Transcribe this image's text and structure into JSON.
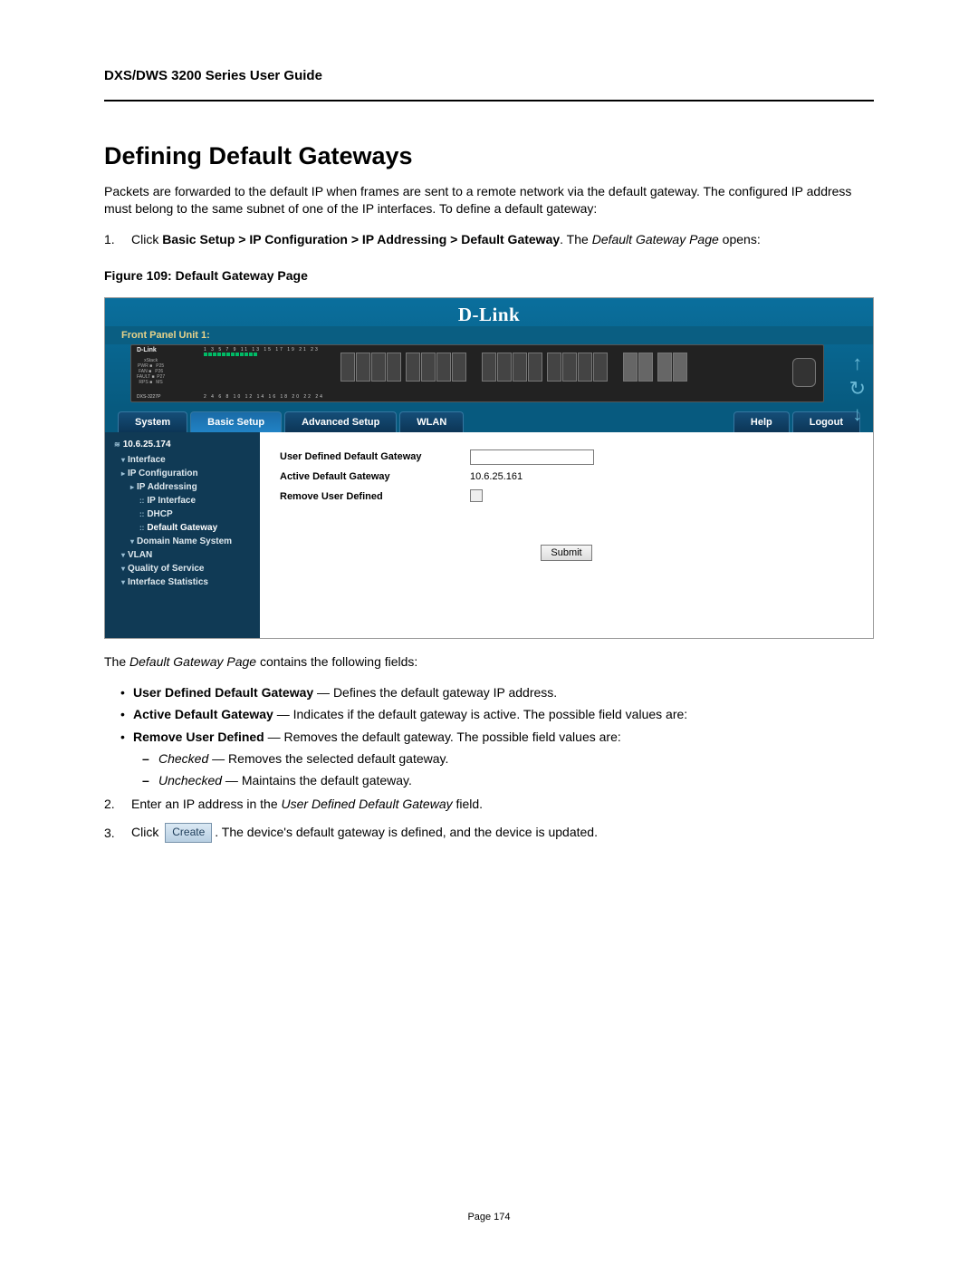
{
  "header": {
    "guide_title": "DXS/DWS 3200 Series User Guide"
  },
  "section_title": "Defining Default Gateways",
  "intro": "Packets are forwarded to the default IP when frames are sent to a remote network via the default gateway. The configured IP address must belong to the same subnet of one of the IP interfaces. To define a default gateway:",
  "step1": {
    "num": "1.",
    "pre": "Click ",
    "path": "Basic Setup > IP Configuration > IP Addressing > Default Gateway",
    "post1": ". The ",
    "ital": "Default Gateway Page",
    "post2": " opens:"
  },
  "figure_caption_prefix": "Figure 109:",
  "figure_caption_title": "Default Gateway Page",
  "ui": {
    "brand": "D-Link",
    "front_panel": "Front Panel Unit 1:",
    "device_brand": "D-Link",
    "port_top_nums": "1 3 5 7 9 11 13 15 17 19 21 23",
    "port_bot_nums": "2 4 6 8 10 12 14 16 18 20 22 24",
    "status_lines": "xStack\nPWR ■   P25\nFAN ■   P26\nFAULT ■  P27\nRPS ■   MS",
    "model": "DXS-3227P",
    "tabs": {
      "system": "System",
      "basic": "Basic Setup",
      "advanced": "Advanced Setup",
      "wlan": "WLAN",
      "help": "Help",
      "logout": "Logout"
    },
    "tree": {
      "root": "10.6.25.174",
      "interface": "Interface",
      "ipconf": "IP Configuration",
      "ipaddr": "IP Addressing",
      "ipiface": "IP Interface",
      "dhcp": "DHCP",
      "defgw": "Default Gateway",
      "dns": "Domain Name System",
      "vlan": "VLAN",
      "qos": "Quality of Service",
      "ifstats": "Interface Statistics"
    },
    "form": {
      "user_defined_label": "User Defined Default Gateway",
      "active_label": "Active Default Gateway",
      "active_value": "10.6.25.161",
      "remove_label": "Remove User Defined",
      "submit": "Submit"
    }
  },
  "after": {
    "contains": "The Default Gateway Page contains the following fields:",
    "b1_bold": "User Defined Default Gateway",
    "b1_rest": " — Defines the default gateway IP address.",
    "b2_bold": "Active Default Gateway",
    "b2_rest": " — Indicates if the default gateway is active. The possible field values are:",
    "b3_bold": "Remove User Defined",
    "b3_rest": " — Removes the default gateway. The possible field values are:",
    "d1_ital": "Checked",
    "d1_rest": " — Removes the selected default gateway.",
    "d2_ital": "Unchecked",
    "d2_rest": " — Maintains the default gateway.",
    "step2_num": "2.",
    "step2_pre": "Enter an IP address in the ",
    "step2_ital": "User Defined Default Gateway",
    "step2_post": " field.",
    "step3_num": "3.",
    "step3_pre": "Click ",
    "create_btn": "Create",
    "step3_post": ". The device's default gateway is defined, and the device is updated."
  },
  "page_number": "Page 174"
}
